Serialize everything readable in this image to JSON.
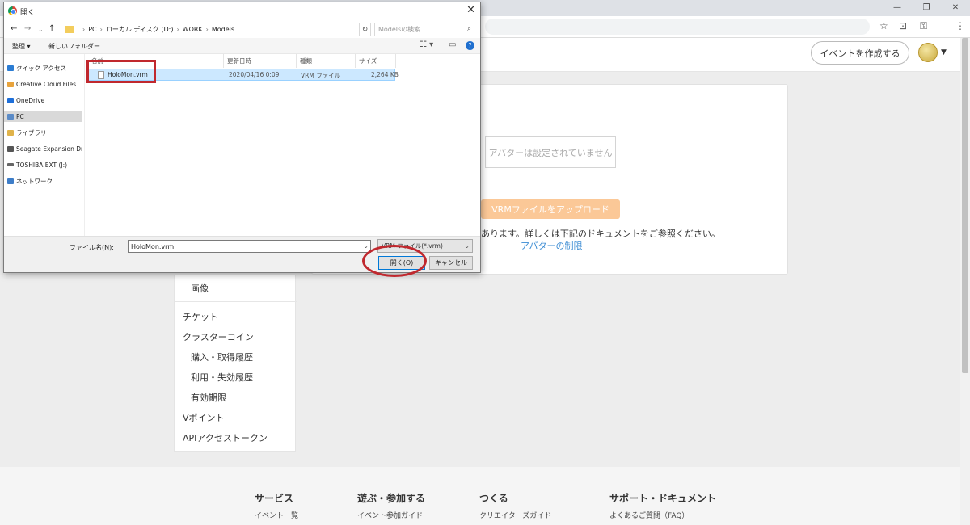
{
  "browser": {
    "window_controls": [
      "—",
      "❐",
      "✕"
    ],
    "toolbar_icons": [
      "☆",
      "⊡",
      "⚿",
      "⋮"
    ]
  },
  "header": {
    "create_event_label": "イベントを作成する"
  },
  "main": {
    "avatar_placeholder": "アバターは設定されていません",
    "upload_label": "VRMファイルをアップロード",
    "note_text": "あります。詳しくは下記のドキュメントをご参照ください。",
    "limits_link": "アバターの制限"
  },
  "sidenav": {
    "items": [
      {
        "label": "画像",
        "indent": true
      },
      {
        "label": "チケット",
        "indent": false
      },
      {
        "label": "クラスターコイン",
        "indent": false
      },
      {
        "label": "購入・取得履歴",
        "indent": true
      },
      {
        "label": "利用・失効履歴",
        "indent": true
      },
      {
        "label": "有効期限",
        "indent": true
      },
      {
        "label": "Vポイント",
        "indent": false
      },
      {
        "label": "APIアクセストークン",
        "indent": false
      }
    ]
  },
  "footer": {
    "columns": [
      {
        "heading": "サービス",
        "link": "イベント一覧"
      },
      {
        "heading": "遊ぶ・参加する",
        "link": "イベント参加ガイド"
      },
      {
        "heading": "つくる",
        "link": "クリエイターズガイド"
      },
      {
        "heading": "サポート・ドキュメント",
        "link": "よくあるご質問（FAQ）"
      }
    ]
  },
  "dialog": {
    "title": "開く",
    "breadcrumb": [
      "PC",
      "ローカル ディスク (D:)",
      "WORK",
      "Models"
    ],
    "search_placeholder": "Modelsの検索",
    "toolbar": {
      "organize": "整理 ▾",
      "new_folder": "新しいフォルダー"
    },
    "nav_pane": [
      {
        "label": "クイック アクセス",
        "color": "#2b7cd3"
      },
      {
        "label": "Creative Cloud Files",
        "color": "#e8a33c"
      },
      {
        "label": "OneDrive",
        "color": "#1e6fd9"
      },
      {
        "label": "PC",
        "color": "#5b8bc7",
        "selected": true
      },
      {
        "label": "ライブラリ",
        "color": "#e0b34a"
      },
      {
        "label": "Seagate Expansion Dr",
        "color": "#555555"
      },
      {
        "label": "TOSHIBA EXT (J:)",
        "color": "#666666"
      },
      {
        "label": "ネットワーク",
        "color": "#3d7dc8"
      }
    ],
    "columns": [
      "名前",
      "更新日時",
      "種類",
      "サイズ"
    ],
    "files": [
      {
        "name": "HoloMon.vrm",
        "modified": "2020/04/16 0:09",
        "type": "VRM ファイル",
        "size": "2,264 KB"
      }
    ],
    "filename_label": "ファイル名(N):",
    "filename_value": "HoloMon.vrm",
    "filetype_value": "VRM ファイル(*.vrm)",
    "open_label": "開く(O)",
    "cancel_label": "キャンセル"
  },
  "colors": {
    "annotation_red": "#c0282e",
    "upload_orange": "#fbc897",
    "link_blue": "#3a8bd3"
  }
}
